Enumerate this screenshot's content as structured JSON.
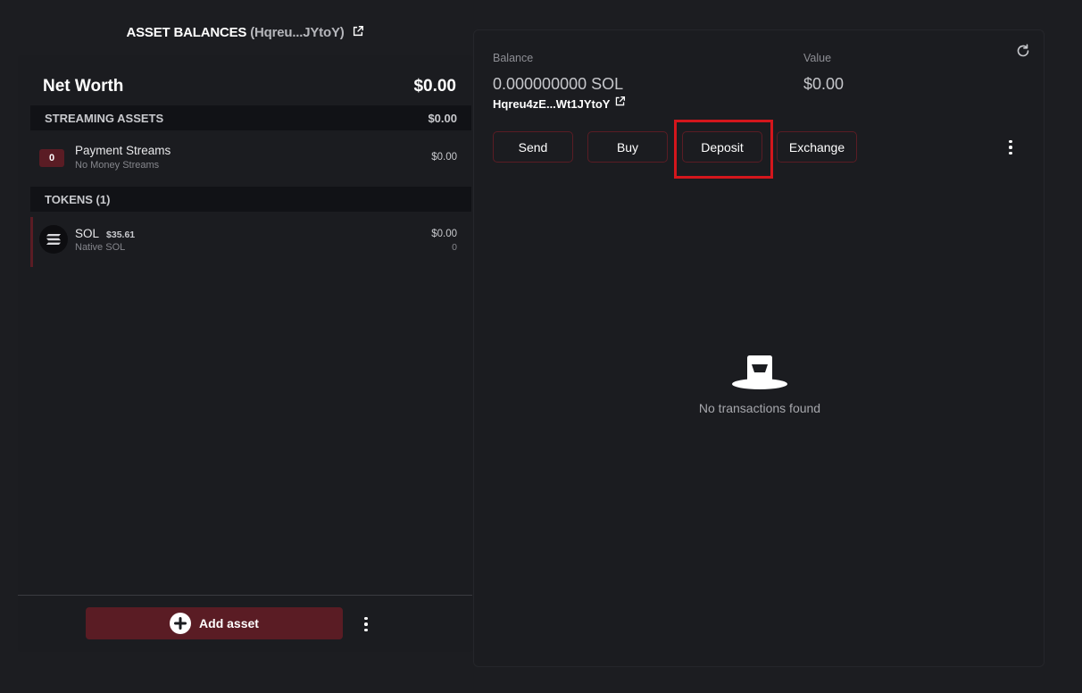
{
  "left": {
    "header_title": "ASSET BALANCES",
    "header_account": "(Hqreu...JYtoY)",
    "net_worth_label": "Net Worth",
    "net_worth_value": "$0.00",
    "streaming": {
      "section_label": "STREAMING ASSETS",
      "section_total": "$0.00",
      "item": {
        "count": "0",
        "title": "Payment Streams",
        "subtitle": "No Money Streams",
        "amount": "$0.00"
      }
    },
    "tokens": {
      "section_label": "TOKENS (1)",
      "items": [
        {
          "symbol": "SOL",
          "price": "$35.61",
          "name": "Native SOL",
          "value": "$0.00",
          "amount": "0",
          "icon": "solana-icon"
        }
      ]
    },
    "add_asset_label": "Add asset"
  },
  "right": {
    "balance_label": "Balance",
    "balance_value": "0.000000000 SOL",
    "value_label": "Value",
    "value_amount": "$0.00",
    "address": "Hqreu4zE...Wt1JYtoY",
    "actions": {
      "send": "Send",
      "buy": "Buy",
      "deposit": "Deposit",
      "exchange": "Exchange"
    },
    "empty_message": "No transactions found"
  },
  "colors": {
    "background": "#1c1d21",
    "panel": "#1b1c20",
    "section_bar": "#111216",
    "accent": "#5a1c24",
    "highlight": "#d4161c"
  }
}
